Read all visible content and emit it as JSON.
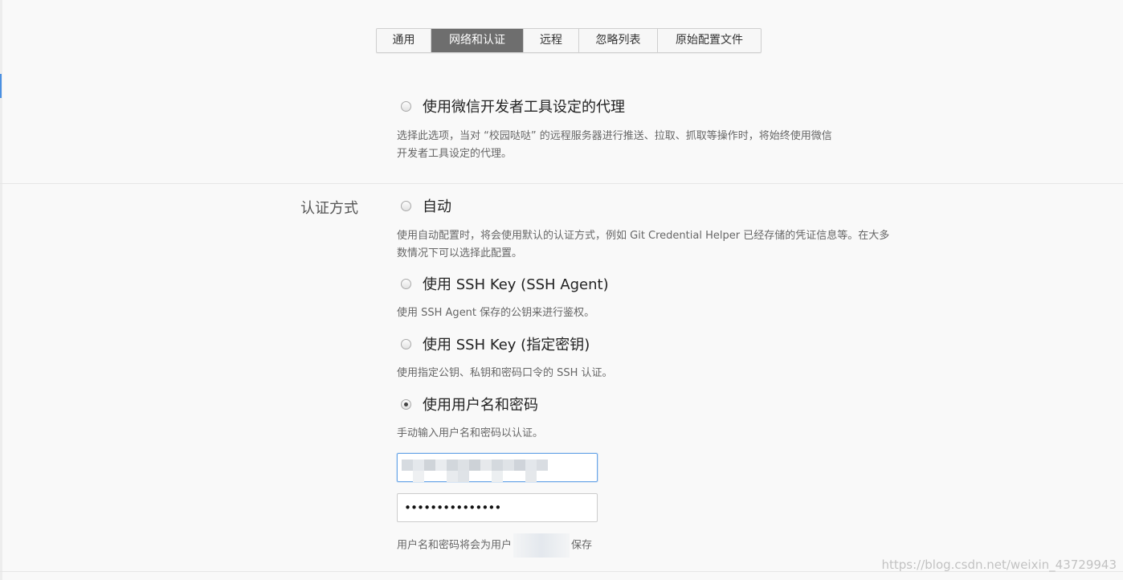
{
  "tabs": [
    {
      "label": "通用",
      "active": false
    },
    {
      "label": "网络和认证",
      "active": true
    },
    {
      "label": "远程",
      "active": false
    },
    {
      "label": "忽略列表",
      "active": false
    },
    {
      "label": "原始配置文件",
      "active": false
    }
  ],
  "proxy": {
    "option_label": "使用微信开发者工具设定的代理",
    "checked": false,
    "description_line1": "选择此选项，当对 “校园哒哒” 的远程服务器进行推送、拉取、抓取等操作时，将始终使用微信",
    "description_line2": "开发者工具设定的代理。"
  },
  "auth": {
    "section_label": "认证方式",
    "options": [
      {
        "label": "自动",
        "checked": false,
        "description_line1": "使用自动配置时，将会使用默认的认证方式，例如 Git Credential Helper 已经存储的凭证信息等。在大多",
        "description_line2": "数情况下可以选择此配置。"
      },
      {
        "label": "使用 SSH Key (SSH Agent)",
        "checked": false,
        "description_line1": "使用 SSH Agent 保存的公钥来进行鉴权。"
      },
      {
        "label": "使用 SSH Key (指定密钥)",
        "checked": false,
        "description_line1": "使用指定公钥、私钥和密码口令的 SSH 认证。"
      },
      {
        "label": "使用用户名和密码",
        "checked": true,
        "description_line1": "手动输入用户名和密码以认证。"
      }
    ],
    "username_value": "",
    "password_value": "•••••••••••••••",
    "save_note_prefix": "用户名和密码将会为用户",
    "save_note_suffix": "保存"
  },
  "watermark": "https://blog.csdn.net/weixin_43729943",
  "colors": {
    "active_tab_bg": "#6e6e6e",
    "focus_border": "#6aa6e8",
    "background": "#f9f9f9"
  }
}
